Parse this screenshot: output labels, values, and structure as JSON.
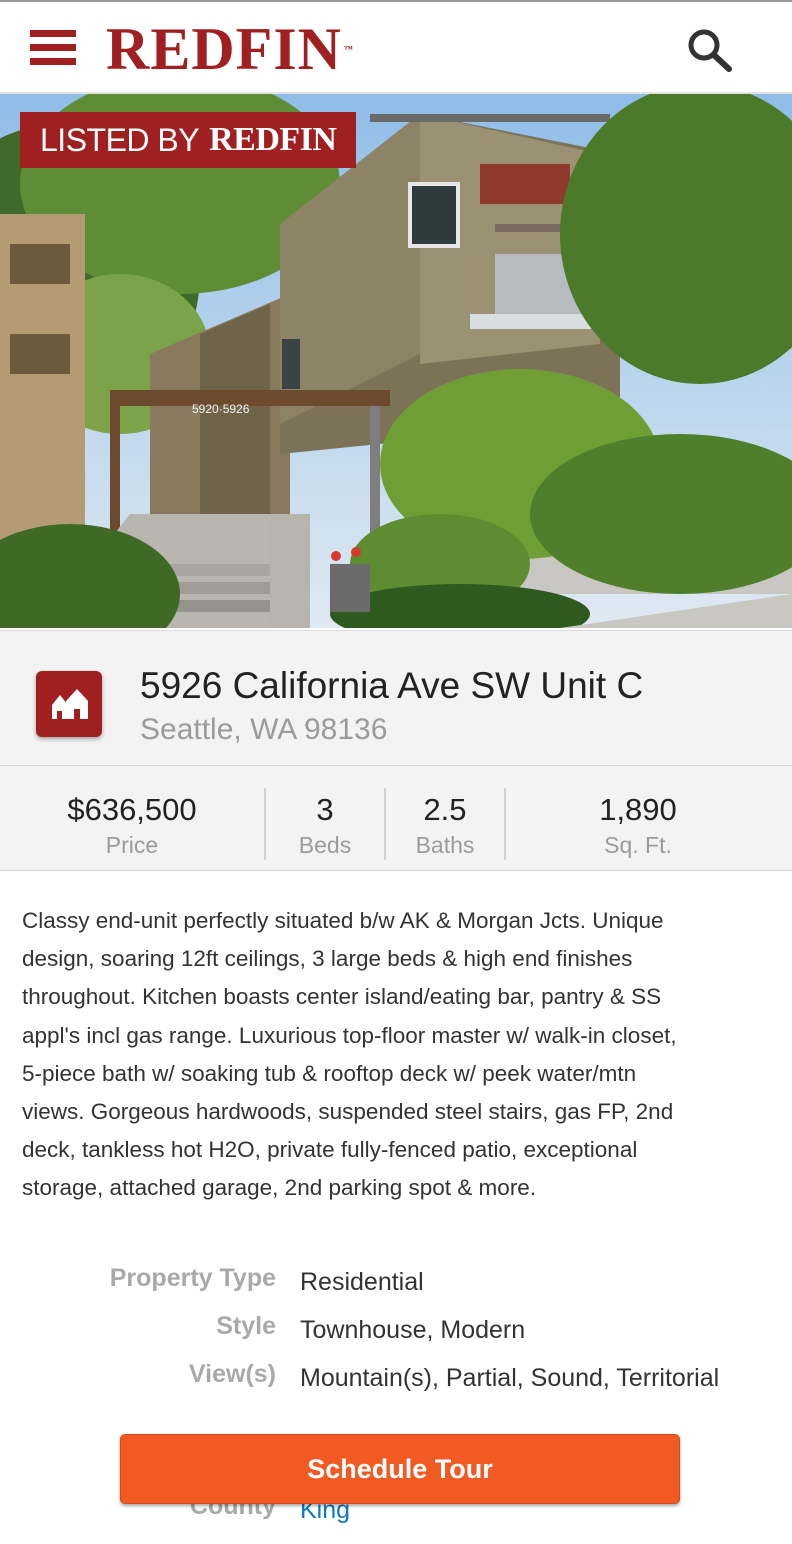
{
  "header": {
    "logo_text": "REDFIN",
    "logo_tm": "™",
    "menu_icon": "hamburger-icon",
    "search_icon": "search-icon"
  },
  "hero": {
    "badge_prefix": "LISTED BY",
    "badge_brand": "REDFIN",
    "sign_text": "5920·5926"
  },
  "listing": {
    "address_line1": "5926 California Ave SW Unit C",
    "address_line2": "Seattle, WA 98136",
    "icon": "house-icon"
  },
  "stats": [
    {
      "value": "$636,500",
      "label": "Price"
    },
    {
      "value": "3",
      "label": "Beds"
    },
    {
      "value": "2.5",
      "label": "Baths"
    },
    {
      "value": "1,890",
      "label": "Sq. Ft."
    }
  ],
  "description": [
    "Classy end-unit perfectly situated b/w AK & Morgan Jcts. Unique",
    "design, soaring 12ft ceilings, 3 large beds & high end finishes",
    "throughout. Kitchen boasts center island/eating bar, pantry & SS",
    "appl's incl gas range. Luxurious top-floor master w/ walk-in closet,",
    "5-piece bath w/ soaking tub & rooftop deck w/ peek water/mtn",
    "views. Gorgeous hardwoods, suspended steel stairs, gas FP, 2nd",
    "deck, tankless hot H2O, private fully-fenced patio, exceptional",
    "storage, attached garage, 2nd parking spot & more."
  ],
  "details": [
    {
      "key": "Property Type",
      "value": "Residential"
    },
    {
      "key": "Style",
      "value": "Townhouse, Modern"
    },
    {
      "key": "View(s)",
      "value": "Mountain(s), Partial, Sound, Territorial"
    },
    {
      "key": "County",
      "value": "King"
    }
  ],
  "cta": {
    "label": "Schedule Tour"
  },
  "colors": {
    "brand": "#a02021",
    "cta": "#f15a22",
    "link": "#0c7ac1"
  }
}
